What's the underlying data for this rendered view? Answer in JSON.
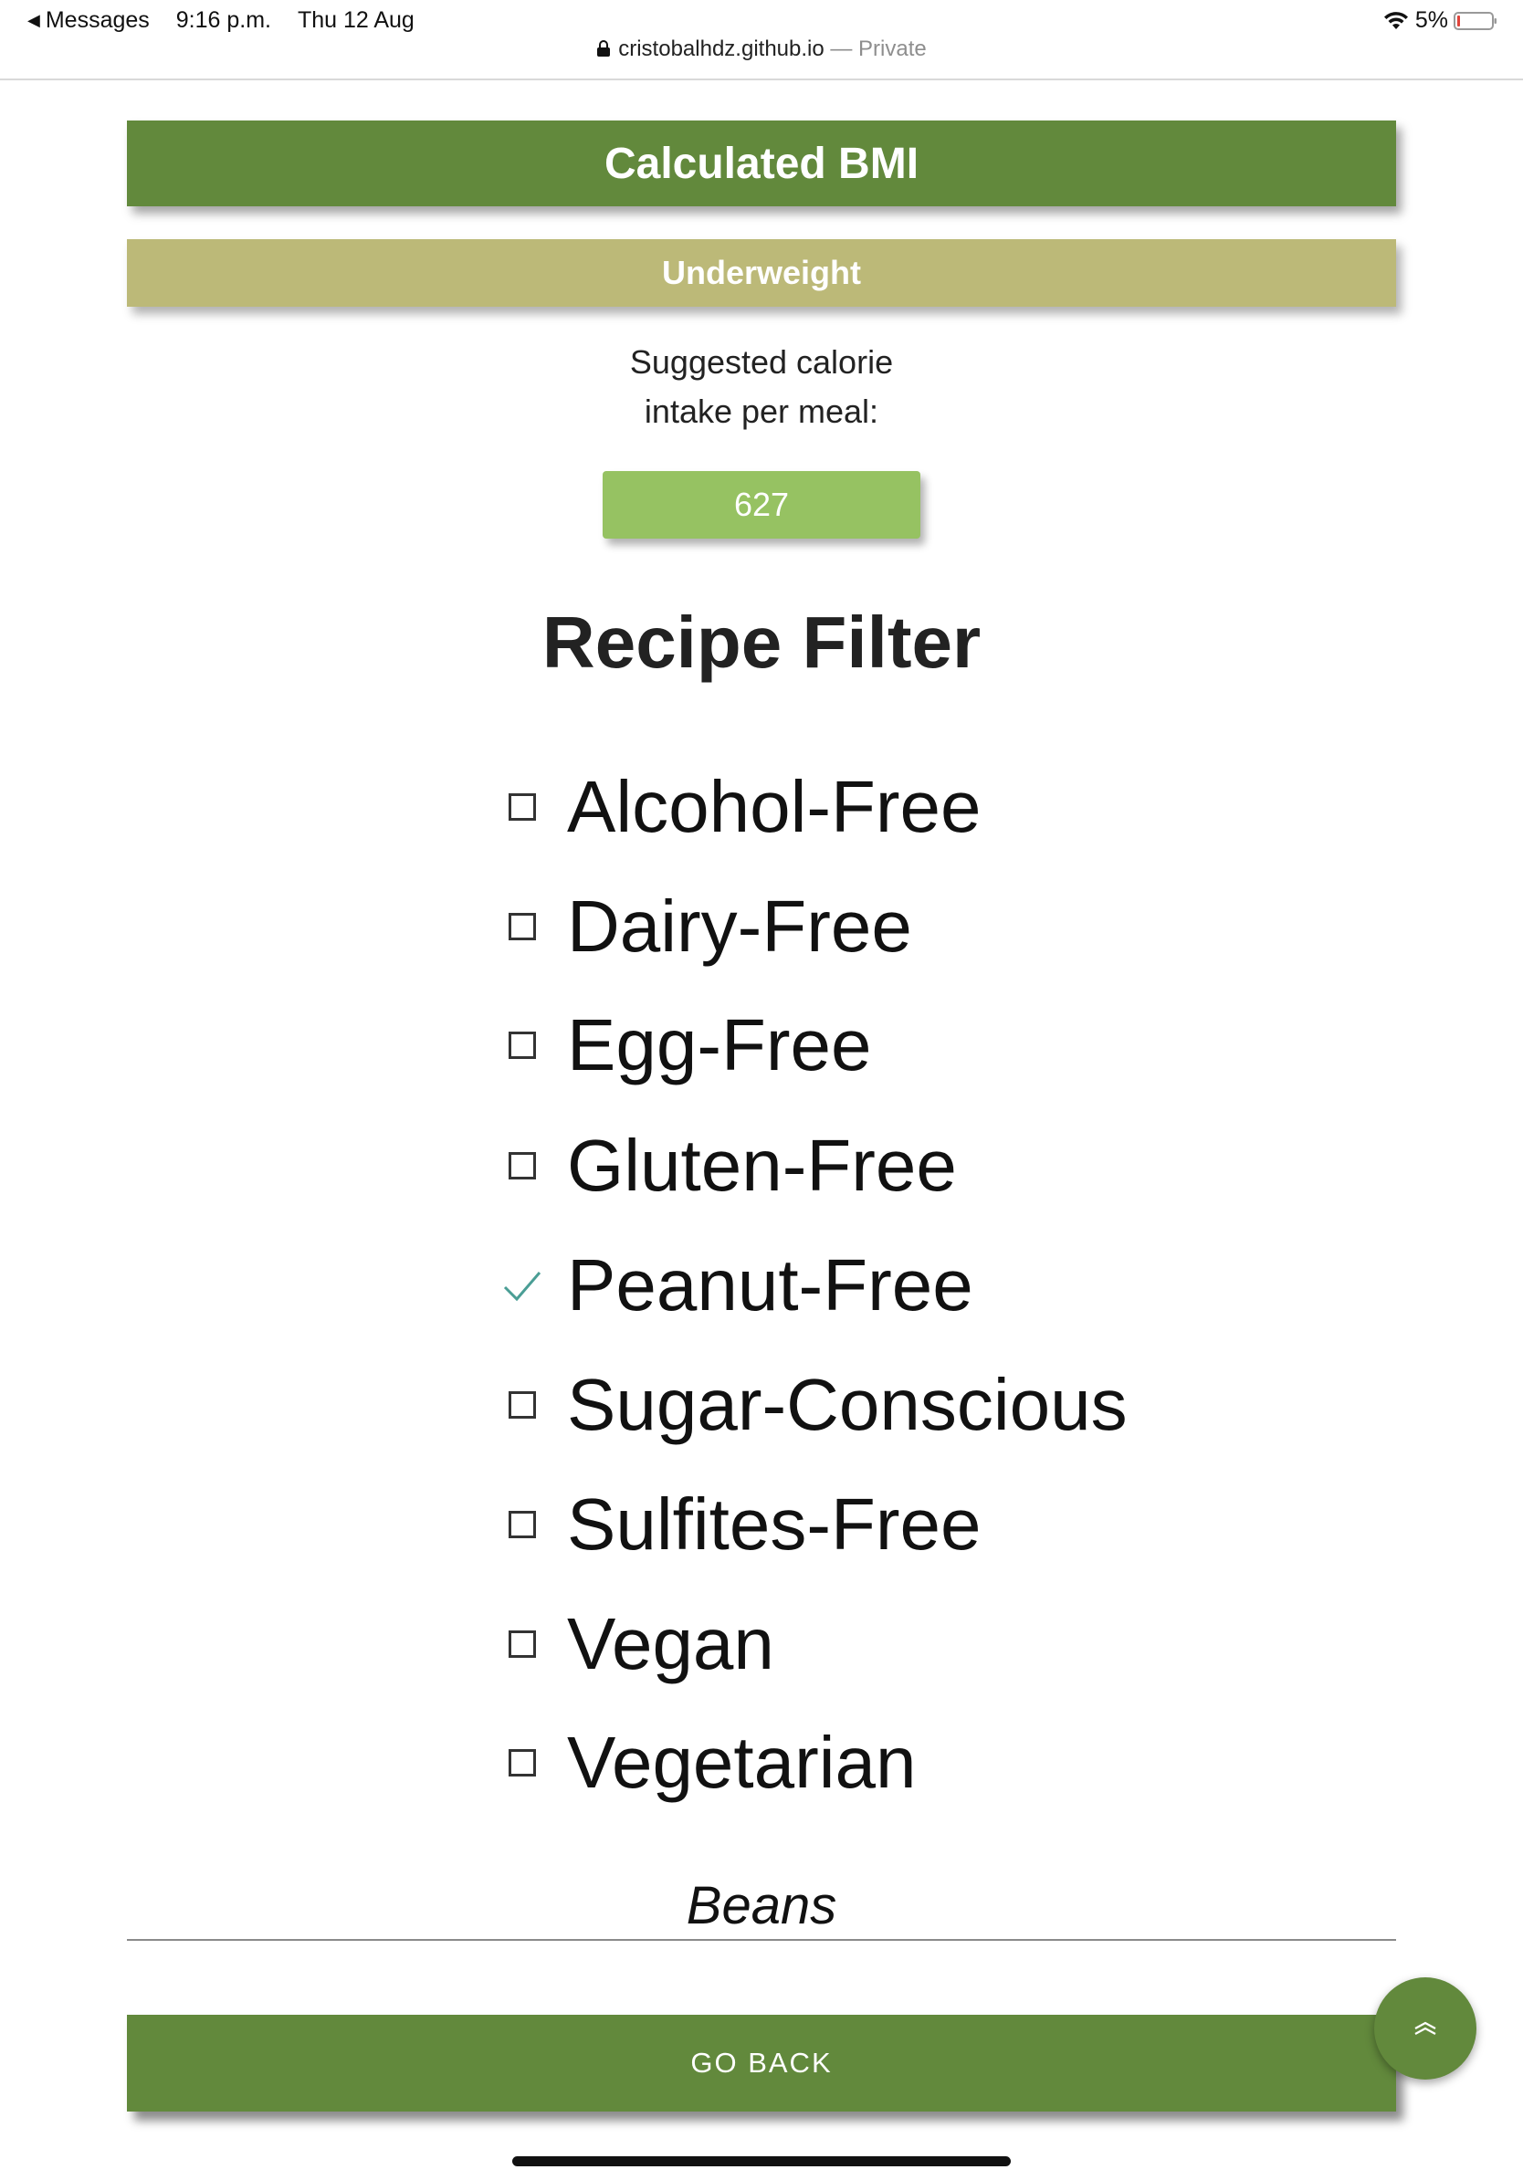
{
  "status_bar": {
    "back_app": "Messages",
    "time": "9:16 p.m.",
    "date": "Thu 12 Aug",
    "battery": "5%",
    "url": "cristobalhdz.github.io",
    "url_separator": " — ",
    "private_label": "Private"
  },
  "bmi": {
    "header": "Calculated BMI",
    "category": "Underweight",
    "category_color": "#bcb978",
    "header_color": "#62893c"
  },
  "calories": {
    "label_line1": "Suggested calorie",
    "label_line2": "intake per meal:",
    "value": "627",
    "badge_color": "#96c262"
  },
  "filter": {
    "title": "Recipe Filter",
    "items": [
      {
        "label": "Alcohol-Free",
        "checked": false
      },
      {
        "label": "Dairy-Free",
        "checked": false
      },
      {
        "label": "Egg-Free",
        "checked": false
      },
      {
        "label": "Gluten-Free",
        "checked": false
      },
      {
        "label": "Peanut-Free",
        "checked": true
      },
      {
        "label": "Sugar-Conscious",
        "checked": false
      },
      {
        "label": "Sulfites-Free",
        "checked": false
      },
      {
        "label": "Vegan",
        "checked": false
      },
      {
        "label": "Vegetarian",
        "checked": false
      }
    ]
  },
  "recipe": {
    "name": "Beans"
  },
  "actions": {
    "go_back": "GO BACK",
    "scroll_top_icon": "double-chevron-up-icon"
  }
}
